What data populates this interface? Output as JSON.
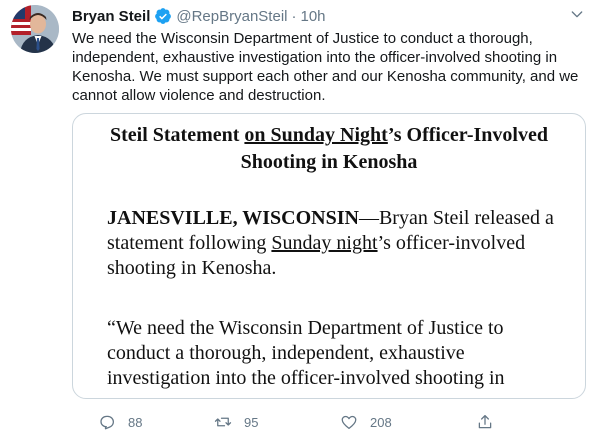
{
  "tweet": {
    "display_name": "Bryan Steil",
    "handle": "@RepBryanSteil",
    "separator": "·",
    "time": "10h",
    "text": "We need the Wisconsin Department of Justice to conduct a thorough, independent, exhaustive investigation into the officer-involved shooting in Kenosha. We must support each other and our Kenosha community, and we cannot allow violence and destruction.",
    "verified_icon": "verified-badge-icon",
    "more_icon": "chevron-down-icon"
  },
  "document": {
    "title_part1": "Steil Statement ",
    "title_underlined": "on Sunday Night",
    "title_part2": "’s Officer-Involved Shooting in Kenosha",
    "dateline": "JANESVILLE, WISCONSIN",
    "p1_part1": "—Bryan Steil released a statement following ",
    "p1_underlined": "Sunday night",
    "p1_part2": "’s officer-involved shooting in Kenosha.",
    "p2": "“We need the Wisconsin Department of Justice to conduct a thorough, independent, exhaustive investigation into the officer-involved shooting in"
  },
  "actions": {
    "reply": {
      "icon": "reply-icon",
      "count": "88"
    },
    "retweet": {
      "icon": "retweet-icon",
      "count": "95"
    },
    "like": {
      "icon": "heart-icon",
      "count": "208"
    },
    "share": {
      "icon": "share-icon"
    }
  },
  "colors": {
    "text": "#14171a",
    "secondary": "#657786",
    "verified": "#1da1f2",
    "border": "#ccd6dd"
  }
}
